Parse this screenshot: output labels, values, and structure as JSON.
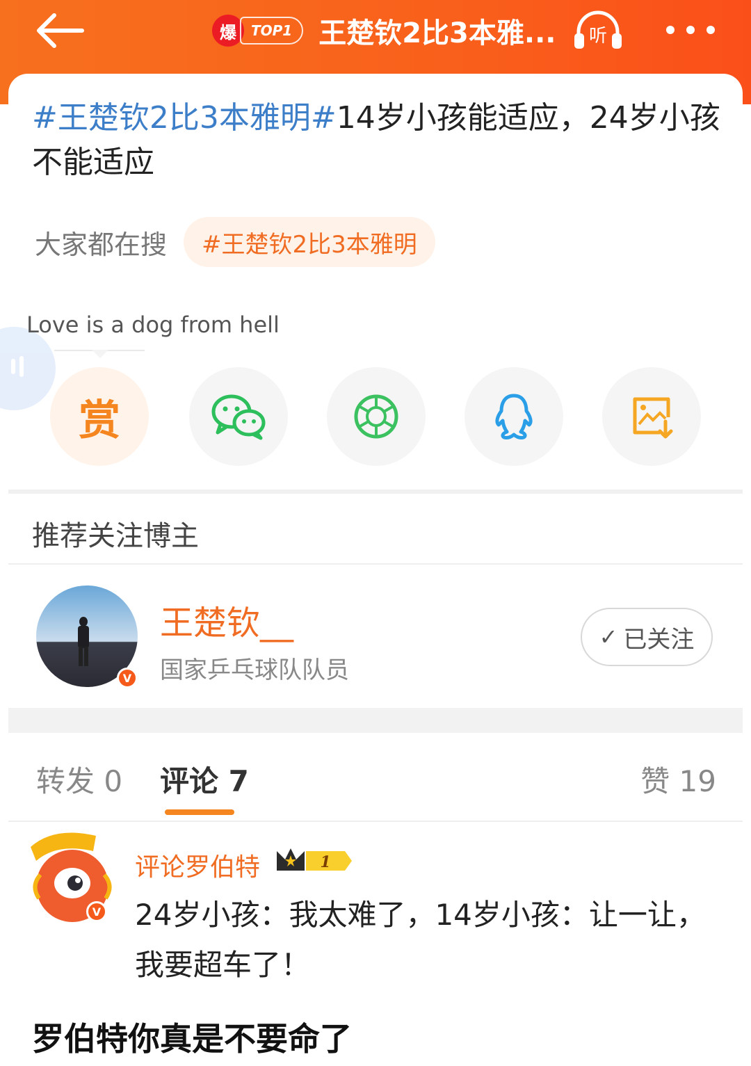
{
  "header": {
    "hot_badge": "爆",
    "rank_badge": "TOP1",
    "title": "王楚钦2比3本雅...",
    "listen_label": "听",
    "back_icon": "back-arrow-icon",
    "more_icon": "more-dots-icon"
  },
  "post": {
    "hashtag": "#王楚钦2比3本雅明#",
    "text": "14岁小孩能适应，24岁小孩不能适应"
  },
  "search": {
    "label": "大家都在搜",
    "chip": "#王楚钦2比3本雅明"
  },
  "bubble": {
    "text": "Love is a dog from hell"
  },
  "share": {
    "reward_label": "赏",
    "items": [
      "reward-icon",
      "wechat-icon",
      "moments-icon",
      "qq-icon",
      "save-image-icon"
    ]
  },
  "recommend": {
    "section_title": "推荐关注博主",
    "name": "王楚钦__",
    "desc": "国家乒乓球队队员",
    "follow_label": "已关注",
    "verified_mark": "V"
  },
  "tabs": {
    "repost": "转发 0",
    "comments": "评论 7",
    "likes": "赞 19"
  },
  "comment": {
    "author": "评论罗伯特",
    "level": "1",
    "text": "24岁小孩：我太难了，14岁小孩：让一让，我要超车了！",
    "verified_mark": "V"
  },
  "caption": {
    "text": "罗伯特你真是不要命了"
  },
  "colors": {
    "brand_orange": "#f5851f",
    "header_orange": "#f9601b",
    "link_blue": "#3d7ec9",
    "wechat_green": "#2dbf5c",
    "qq_blue": "#2a9fe8"
  }
}
